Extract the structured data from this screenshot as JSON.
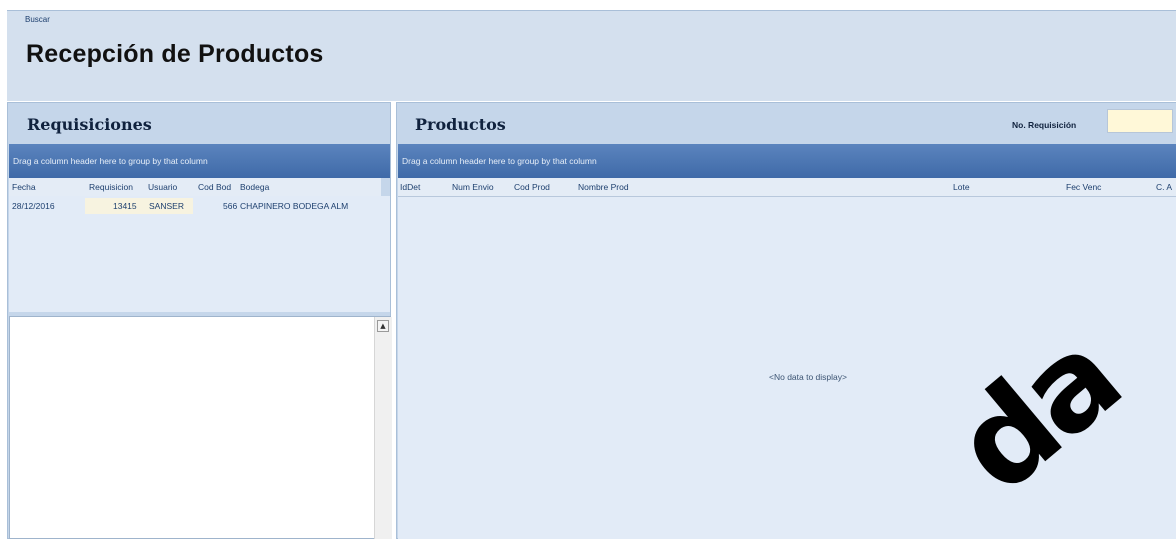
{
  "header": {
    "search_link": "Buscar",
    "title": "Recepción de Productos"
  },
  "requisiciones": {
    "title": "Requisiciones",
    "group_hint": "Drag a column header here to group by that column",
    "columns": [
      "Fecha",
      "Requisicion",
      "Usuario",
      "Cod Bod",
      "Bodega"
    ],
    "rows": [
      {
        "fecha": "28/12/2016",
        "requisicion": "13415",
        "usuario": "SANSER",
        "cod_bod": "566",
        "bodega": "CHAPINERO BODEGA ALM"
      }
    ]
  },
  "productos": {
    "title": "Productos",
    "group_hint": "Drag a column header here to group by that column",
    "columns": [
      "IdDet",
      "Num Envio",
      "Cod Prod",
      "Nombre Prod",
      "Lote",
      "Fec Venc",
      "C. A"
    ],
    "empty_text": "<No data to display>",
    "requisicion_label": "No. Requisición",
    "requisicion_value": ""
  },
  "watermark": "da",
  "colors": {
    "group_bar": "#4a74b0",
    "panel": "#c5d6ea",
    "grid": "#e2ebf7",
    "input": "#fff8d8"
  }
}
